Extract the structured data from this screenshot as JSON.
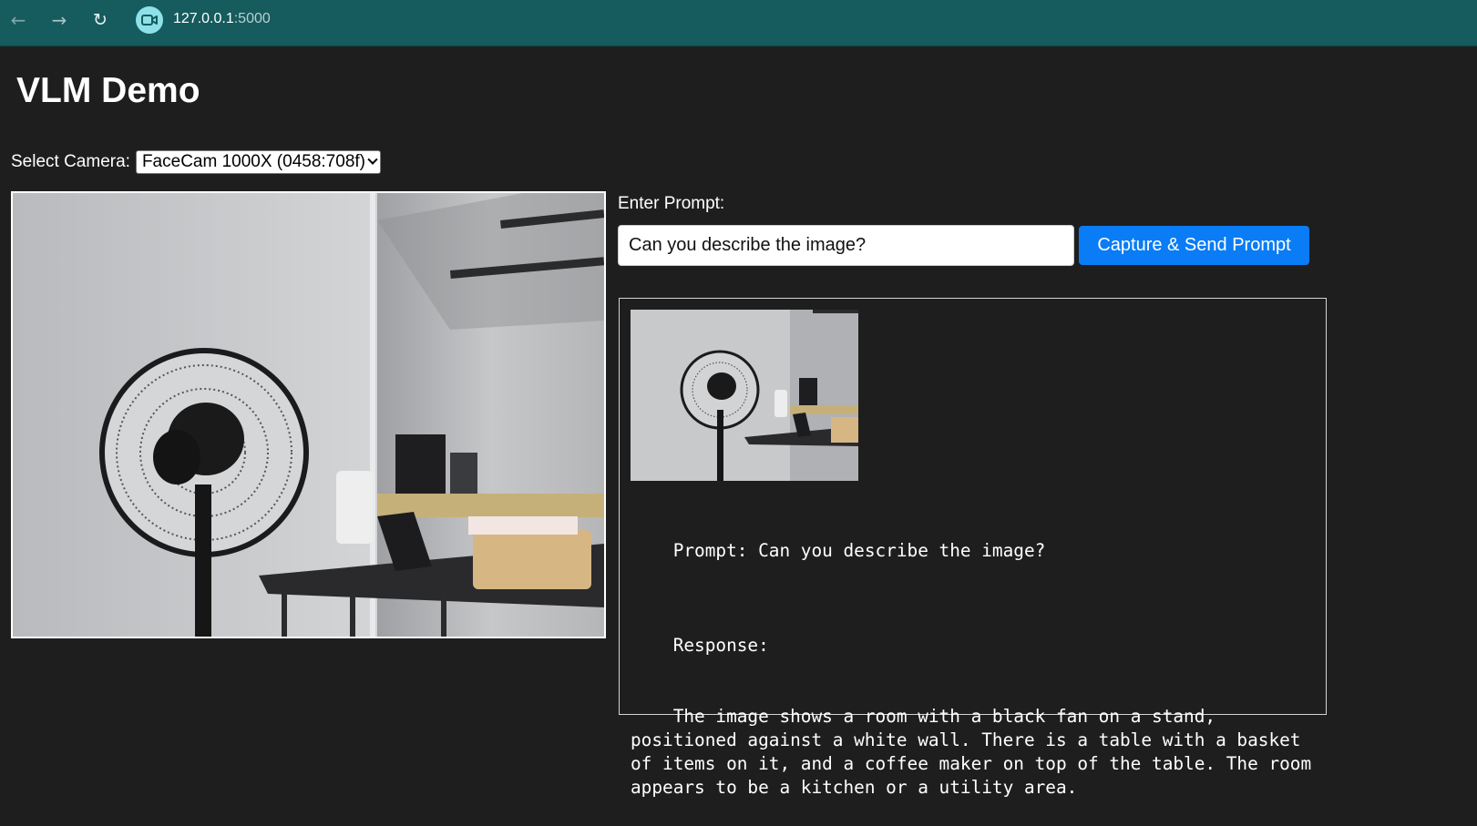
{
  "browser": {
    "back_icon": "arrow-left-icon",
    "forward_icon": "arrow-right-icon",
    "reload_icon": "reload-icon",
    "site_icon": "video-camera-icon",
    "url_host": "127.0.0.1",
    "url_port": ":5000"
  },
  "page": {
    "title": "VLM Demo"
  },
  "camera": {
    "label": "Select Camera:",
    "selected": "FaceCam 1000X (0458:708f)"
  },
  "prompt": {
    "label": "Enter Prompt:",
    "value": "Can you describe the image?",
    "button_label": "Capture & Send Prompt"
  },
  "result": {
    "prompt_line": "Prompt: Can you describe the image?",
    "response_label": "Response:",
    "response_text": "The image shows a room with a black fan on a stand, positioned against a white wall. There is a table with a basket of items on it, and a coffee maker on top of the table. The room appears to be a kitchen or a utility area."
  },
  "colors": {
    "chrome": "#165b5e",
    "page_bg": "#1e1e1e",
    "accent_button": "#0a7cf5"
  }
}
